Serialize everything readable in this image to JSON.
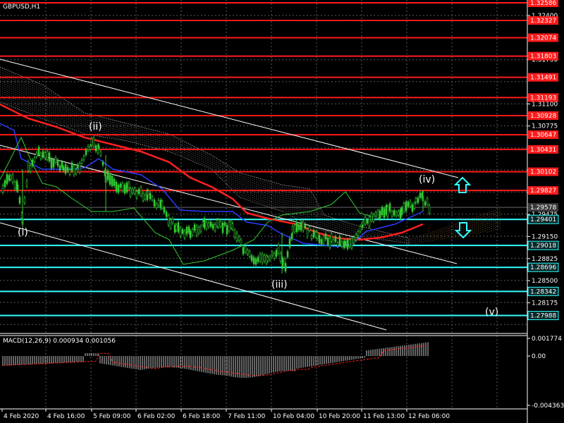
{
  "title": "GBPUSD,H1",
  "indicator_label": "MACD(12,26,9) 0.000934 0.001056",
  "colors": {
    "background": "#000000",
    "grid": "#5a5a5a",
    "resistance": "#ff1a1a",
    "support": "#33ffff",
    "price": "#33cc33",
    "channel": "#ffffff",
    "kijun": "#ff2020",
    "tenkan": "#2a3cff",
    "chikou": "#33cc33",
    "cloud": "#ffffff",
    "cloud_future": "#d8a060",
    "current_price_box": "#3a3a3a"
  },
  "y_axis_labels": [
    "1.32400",
    "1.31750",
    "1.31100",
    "1.30775",
    "1.30125",
    "1.29800",
    "1.29475",
    "1.29150",
    "1.28825",
    "1.28500",
    "1.28175"
  ],
  "price_levels": [
    {
      "price": "1.32586",
      "kind": "resistance"
    },
    {
      "price": "1.32327",
      "kind": "resistance"
    },
    {
      "price": "1.32074",
      "kind": "resistance"
    },
    {
      "price": "1.31803",
      "kind": "resistance"
    },
    {
      "price": "1.31491",
      "kind": "resistance"
    },
    {
      "price": "1.31193",
      "kind": "resistance"
    },
    {
      "price": "1.30928",
      "kind": "resistance"
    },
    {
      "price": "1.30647",
      "kind": "resistance"
    },
    {
      "price": "1.30431",
      "kind": "resistance"
    },
    {
      "price": "1.30102",
      "kind": "resistance"
    },
    {
      "price": "1.29827",
      "kind": "resistance"
    },
    {
      "price": "1.29578",
      "kind": "current"
    },
    {
      "price": "1.29401",
      "kind": "support"
    },
    {
      "price": "1.29018",
      "kind": "support"
    },
    {
      "price": "1.28696",
      "kind": "support"
    },
    {
      "price": "1.28342",
      "kind": "support"
    },
    {
      "price": "1.27988",
      "kind": "support"
    }
  ],
  "macd_axis_labels": [
    "0.001774",
    "0.00",
    "-0.004363"
  ],
  "x_axis_labels": [
    "4 Feb 2020",
    "4 Feb 16:00",
    "5 Feb 09:00",
    "6 Feb 02:00",
    "6 Feb 18:00",
    "7 Feb 11:00",
    "10 Feb 04:00",
    "10 Feb 20:00",
    "11 Feb 13:00",
    "12 Feb 06:00"
  ],
  "wave_labels": [
    "(i)",
    "(ii)",
    "(iii)",
    "(iv)",
    "(v)"
  ],
  "arrows": [
    {
      "name": "up-arrow-icon",
      "direction": "up"
    },
    {
      "name": "down-arrow-icon",
      "direction": "down"
    }
  ]
}
